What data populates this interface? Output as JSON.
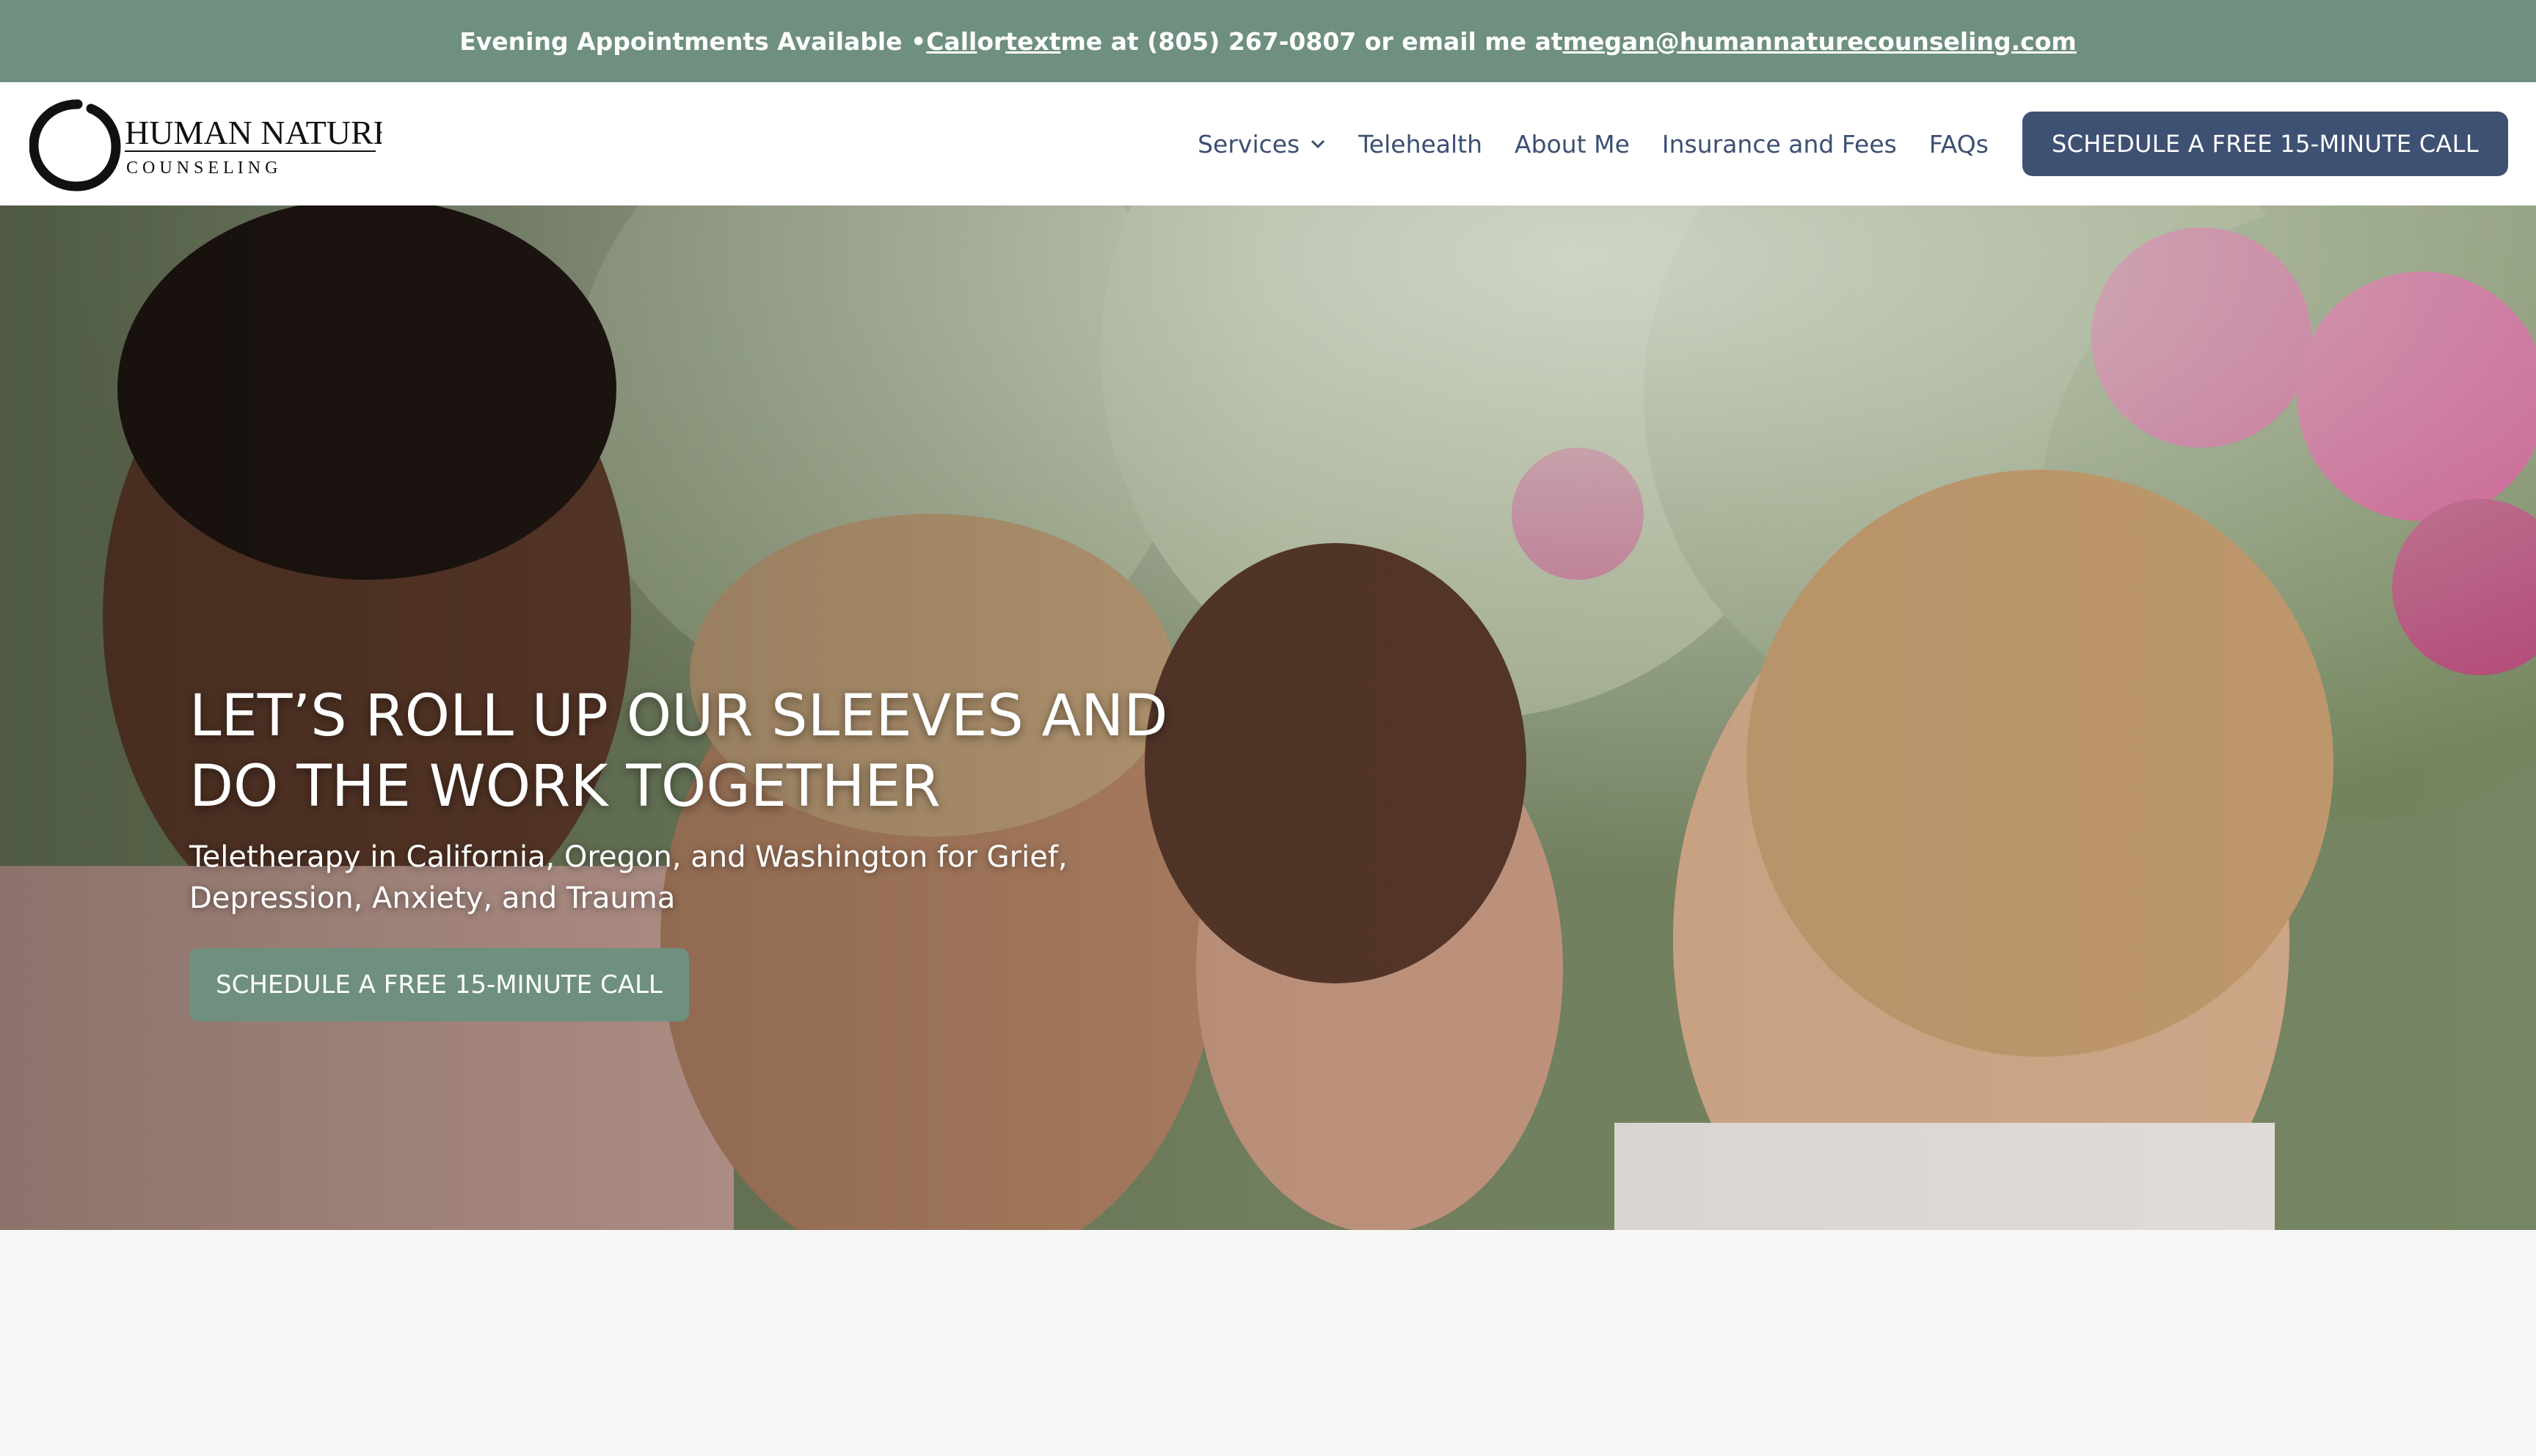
{
  "topbar": {
    "prefix": "Evening Appointments Available • ",
    "call_label": "Call",
    "or_label": " or ",
    "text_label": "text",
    "middle": " me at (805) 267-0807 or email me at ",
    "email": "megan@humannaturecounseling.com"
  },
  "logo": {
    "line1": "HUMAN NATURE",
    "line2": "C O U N S E L I N G"
  },
  "nav": {
    "items": [
      {
        "label": "Services",
        "has_dropdown": true
      },
      {
        "label": "Telehealth"
      },
      {
        "label": "About Me"
      },
      {
        "label": "Insurance and Fees"
      },
      {
        "label": "FAQs"
      }
    ],
    "cta": "SCHEDULE A FREE 15-MINUTE CALL"
  },
  "hero": {
    "title": "LET’S ROLL UP OUR SLEEVES AND DO THE WORK TOGETHER",
    "subtitle": "Teletherapy in California, Oregon, and Washington for Grief, Depression, Anxiety, and Trauma",
    "cta": "SCHEDULE A FREE 15-MINUTE CALL"
  },
  "colors": {
    "topbar_bg": "#6f8f7f",
    "nav_text": "#3d4f73",
    "header_cta_bg": "#3f5173",
    "hero_cta_bg": "#6f8f7f"
  },
  "icons": {
    "dropdown": "chevron-down-icon",
    "logo_mark": "enso-circle-icon"
  }
}
